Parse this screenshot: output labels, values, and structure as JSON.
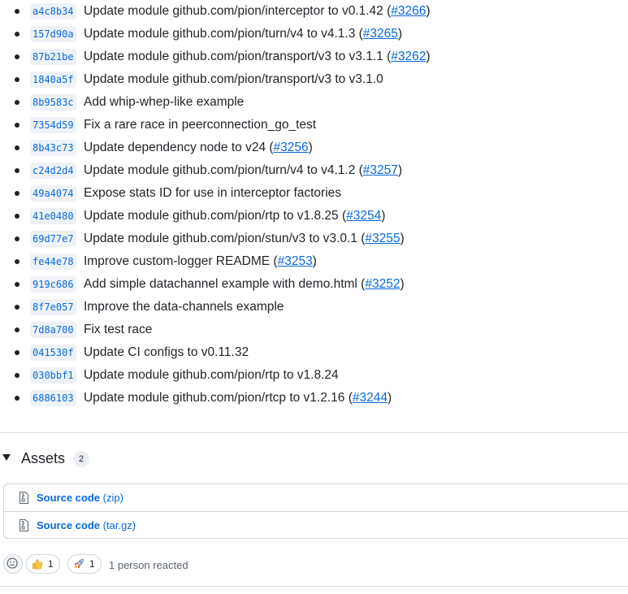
{
  "commits": [
    {
      "sha": "a4c8b34",
      "message": "Update module github.com/pion/interceptor to v0.1.42 (",
      "pr": "#3266",
      "tail": ")"
    },
    {
      "sha": "157d90a",
      "message": "Update module github.com/pion/turn/v4 to v4.1.3 (",
      "pr": "#3265",
      "tail": ")"
    },
    {
      "sha": "87b21be",
      "message": "Update module github.com/pion/transport/v3 to v3.1.1 (",
      "pr": "#3262",
      "tail": ")"
    },
    {
      "sha": "1840a5f",
      "message": "Update module github.com/pion/transport/v3 to v3.1.0",
      "pr": "",
      "tail": ""
    },
    {
      "sha": "8b9583c",
      "message": "Add whip-whep-like example",
      "pr": "",
      "tail": ""
    },
    {
      "sha": "7354d59",
      "message": "Fix a rare race in peerconnection_go_test",
      "pr": "",
      "tail": ""
    },
    {
      "sha": "8b43c73",
      "message": "Update dependency node to v24 (",
      "pr": "#3256",
      "tail": ")"
    },
    {
      "sha": "c24d2d4",
      "message": "Update module github.com/pion/turn/v4 to v4.1.2 (",
      "pr": "#3257",
      "tail": ")"
    },
    {
      "sha": "49a4074",
      "message": "Expose stats ID for use in interceptor factories",
      "pr": "",
      "tail": ""
    },
    {
      "sha": "41e0480",
      "message": "Update module github.com/pion/rtp to v1.8.25 (",
      "pr": "#3254",
      "tail": ")"
    },
    {
      "sha": "69d77e7",
      "message": "Update module github.com/pion/stun/v3 to v3.0.1 (",
      "pr": "#3255",
      "tail": ")"
    },
    {
      "sha": "fe44e78",
      "message": "Improve custom-logger README (",
      "pr": "#3253",
      "tail": ")"
    },
    {
      "sha": "919c686",
      "message": "Add simple datachannel example with demo.html (",
      "pr": "#3252",
      "tail": ")"
    },
    {
      "sha": "8f7e057",
      "message": "Improve the data-channels example",
      "pr": "",
      "tail": ""
    },
    {
      "sha": "7d8a700",
      "message": "Fix test race",
      "pr": "",
      "tail": ""
    },
    {
      "sha": "041530f",
      "message": "Update CI configs to v0.11.32",
      "pr": "",
      "tail": ""
    },
    {
      "sha": "030bbf1",
      "message": "Update module github.com/pion/rtp to v1.8.24",
      "pr": "",
      "tail": ""
    },
    {
      "sha": "6886103",
      "message": "Update module github.com/pion/rtcp to v1.2.16 (",
      "pr": "#3244",
      "tail": ")"
    }
  ],
  "assets": {
    "title": "Assets",
    "count": "2",
    "items": [
      {
        "label": "Source code",
        "ext": "(zip)"
      },
      {
        "label": "Source code",
        "ext": "(tar.gz)"
      }
    ]
  },
  "reactions": {
    "thumbs_up_count": "1",
    "rocket_count": "1",
    "summary": "1 person reacted"
  },
  "colors": {
    "link": "#0969da",
    "text": "#1f2328",
    "muted": "#59636e",
    "border": "#d0d7de"
  }
}
